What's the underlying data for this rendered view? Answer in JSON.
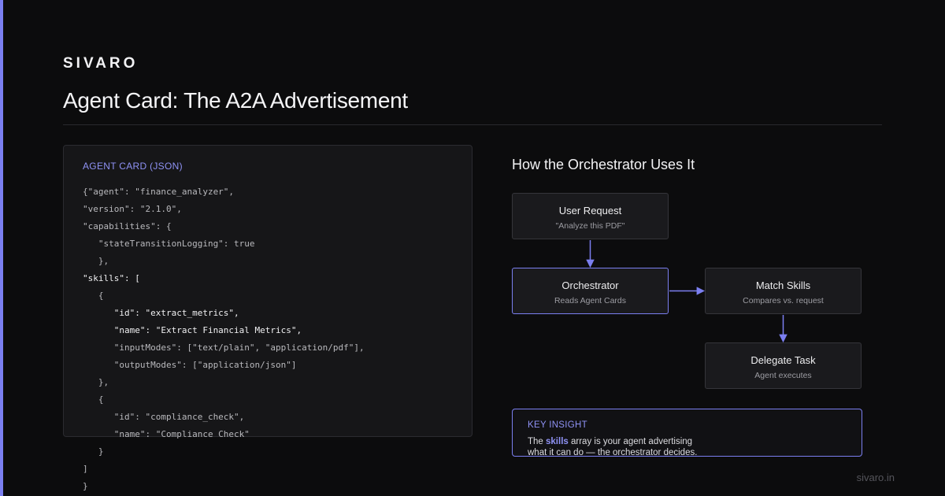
{
  "brand": "SIVARO",
  "title": "Agent Card: The A2A Advertisement",
  "code_card": {
    "label": "AGENT CARD (JSON)",
    "lines": [
      "{\"agent\": \"finance_analyzer\",",
      "\"version\": \"2.1.0\",",
      "\"capabilities\": {",
      "   \"stateTransitionLogging\": true",
      "   },",
      "\"skills\": [",
      "   {",
      "      \"id\": \"extract_metrics\",",
      "      \"name\": \"Extract Financial Metrics\",",
      "      \"inputModes\": [\"text/plain\", \"application/pdf\"],",
      "      \"outputModes\": [\"application/json\"]",
      "   },",
      "   {",
      "      \"id\": \"compliance_check\",",
      "      \"name\": \"Compliance Check\"",
      "   }",
      "]",
      "}"
    ]
  },
  "flow": {
    "title": "How the Orchestrator Uses It",
    "nodes": {
      "user_request": {
        "title": "User Request",
        "subtitle": "\"Analyze this PDF\""
      },
      "orchestrator": {
        "title": "Orchestrator",
        "subtitle": "Reads Agent Cards"
      },
      "match_skills": {
        "title": "Match Skills",
        "subtitle": "Compares vs. request"
      },
      "delegate_task": {
        "title": "Delegate Task",
        "subtitle": "Agent executes"
      }
    }
  },
  "insight": {
    "label": "KEY INSIGHT",
    "text_before": "The ",
    "highlight": "skills",
    "text_after": " array is your agent advertising what it can do — the orchestrator decides."
  },
  "footer": "sivaro.in",
  "colors": {
    "accent": "#7b7ff0",
    "background": "#0c0c0d",
    "card": "#161618"
  }
}
